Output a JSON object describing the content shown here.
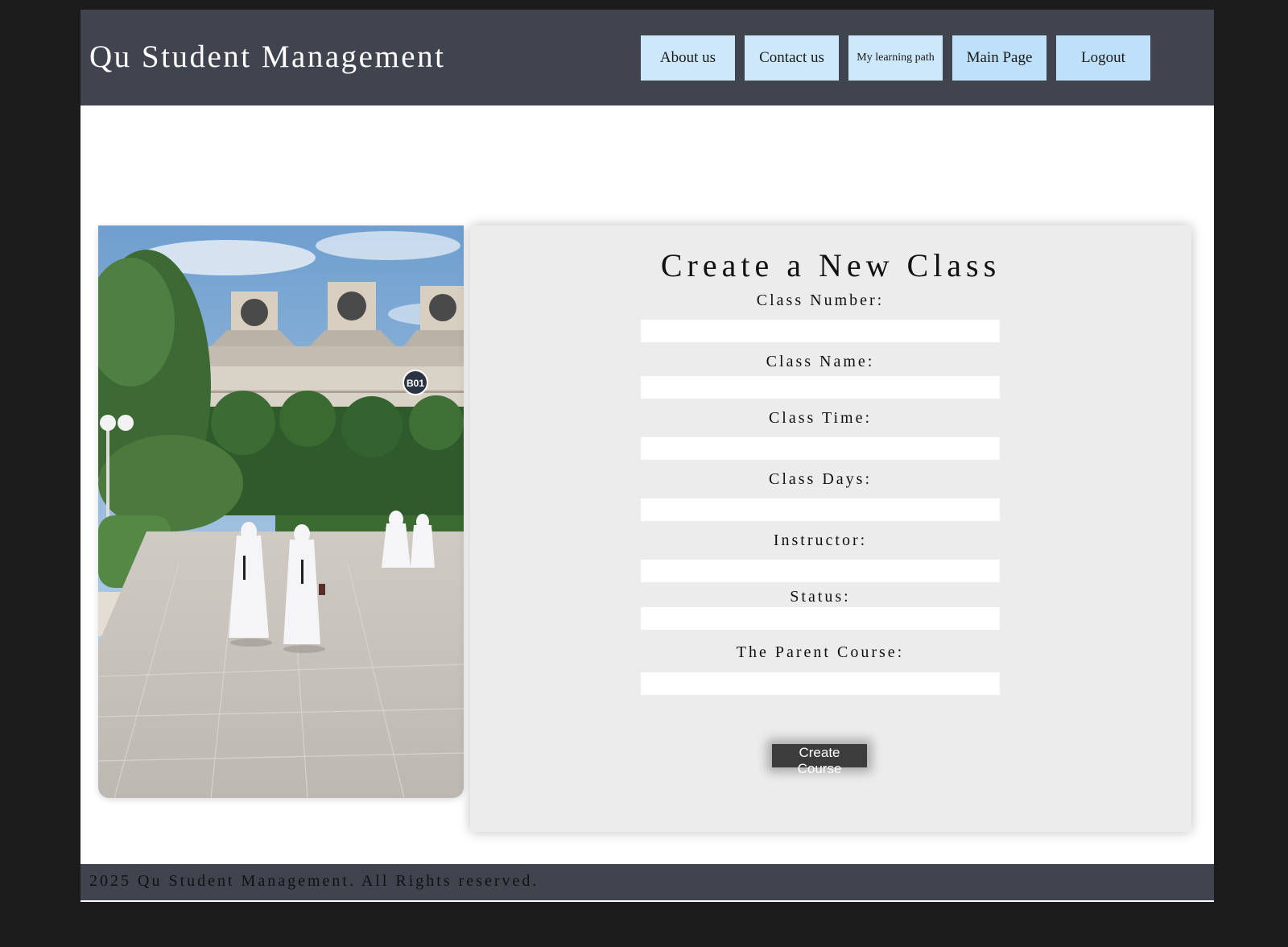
{
  "header": {
    "title": "Qu Student Management",
    "nav": [
      {
        "label": "About us"
      },
      {
        "label": "Contact us"
      },
      {
        "label": "My learning path"
      },
      {
        "label": "Main Page"
      },
      {
        "label": "Logout"
      }
    ]
  },
  "image": {
    "building_sign": "B01"
  },
  "form": {
    "title": "Create a New Class",
    "fields": [
      {
        "label": "Class Number:",
        "value": ""
      },
      {
        "label": "Class Name:",
        "value": ""
      },
      {
        "label": "Class Time:",
        "value": ""
      },
      {
        "label": "Class Days:",
        "value": ""
      },
      {
        "label": "Instructor:",
        "value": ""
      },
      {
        "label": "Status:",
        "value": ""
      },
      {
        "label": "The Parent Course:",
        "value": ""
      }
    ],
    "submit_label": "Create Course"
  },
  "footer": {
    "text": "2025 Qu Student Management. All Rights reserved."
  },
  "colors": {
    "background": "#1c1c1c",
    "header_footer": "#40444f",
    "nav_button": "#cde8fb",
    "form_panel": "#ececec",
    "submit_button": "#3c3c3c"
  }
}
